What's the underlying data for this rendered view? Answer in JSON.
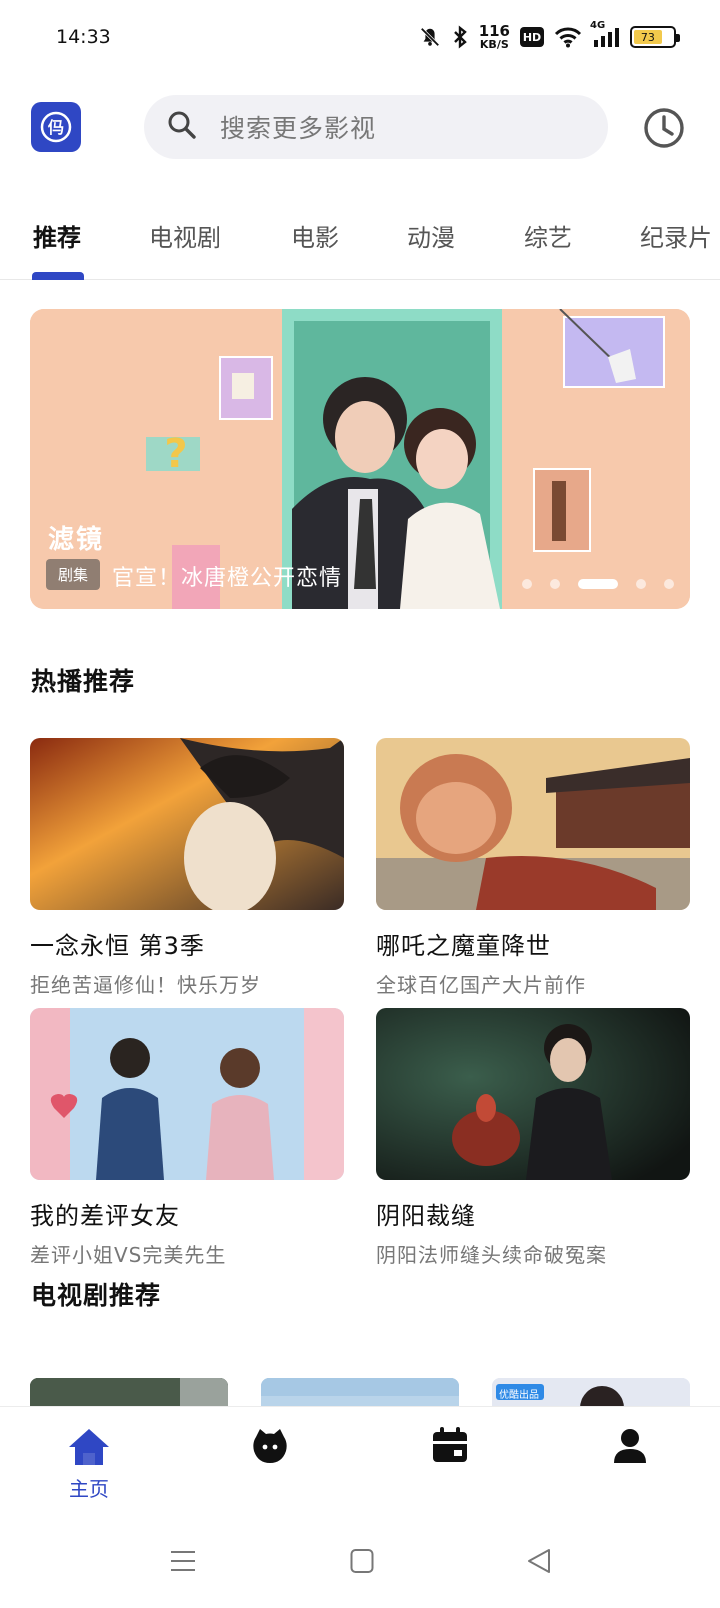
{
  "status_bar": {
    "time": "14:33",
    "net_speed_value": "116",
    "net_speed_unit": "KB/S",
    "hd_label": "HD",
    "signal_label": "4G",
    "battery_level": "73",
    "icons": [
      "mute-bell-icon",
      "bluetooth-icon",
      "wifi-icon",
      "signal-icon",
      "battery-icon"
    ]
  },
  "header": {
    "logo_text": "㐷",
    "search_placeholder": "搜索更多影视",
    "history_icon": "clock-icon"
  },
  "tabs": [
    {
      "label": "推荐",
      "active": true
    },
    {
      "label": "电视剧",
      "active": false
    },
    {
      "label": "电影",
      "active": false
    },
    {
      "label": "动漫",
      "active": false
    },
    {
      "label": "综艺",
      "active": false
    },
    {
      "label": "纪录片",
      "active": false
    }
  ],
  "banner": {
    "title": "滤镜",
    "tag": "剧集",
    "subtitle": "官宣！冰唐橙公开恋情",
    "slide_count": 5,
    "active_slide": 3
  },
  "hot_section": {
    "title": "热播推荐",
    "items": [
      {
        "title": "一念永恒 第3季",
        "desc": "拒绝苦逼修仙！快乐万岁"
      },
      {
        "title": "哪吒之魔童降世",
        "desc": "全球百亿国产大片前作"
      },
      {
        "title": "我的差评女友",
        "desc": "差评小姐VS完美先生"
      },
      {
        "title": "阴阳裁缝",
        "desc": "阴阳法师缝头续命破冤案"
      }
    ]
  },
  "tv_section": {
    "title": "电视剧推荐",
    "thumb_badge": "优酷出品"
  },
  "bottom_nav": {
    "items": [
      {
        "label": "主页",
        "icon": "home-icon",
        "active": true
      },
      {
        "label": "",
        "icon": "mascot-icon",
        "active": false
      },
      {
        "label": "",
        "icon": "calendar-icon",
        "active": false
      },
      {
        "label": "",
        "icon": "person-icon",
        "active": false
      }
    ]
  },
  "colors": {
    "accent": "#2f47c4",
    "banner_bg": "#f7c9ac",
    "search_bg": "#f1f1f5"
  }
}
